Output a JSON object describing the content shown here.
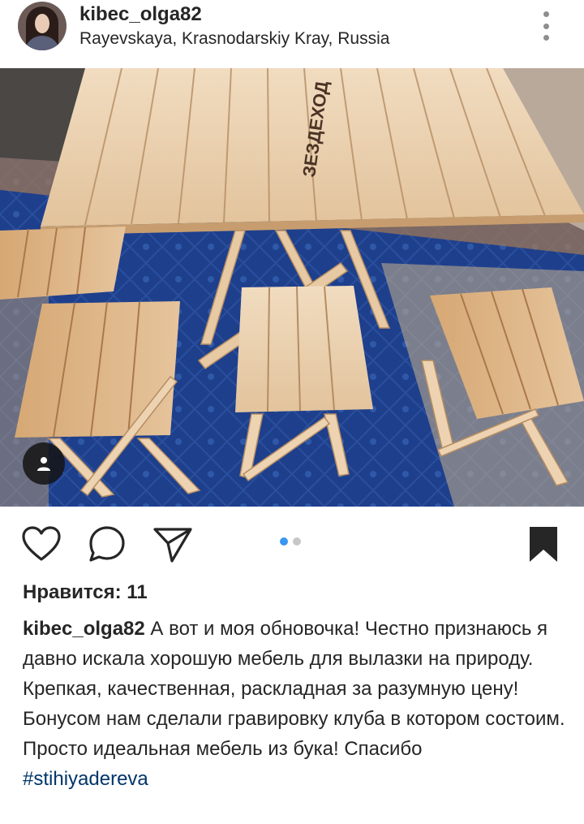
{
  "post": {
    "username": "kibec_olga82",
    "location": "Rayevskaya, Krasnodarskiy Kray, Russia"
  },
  "photo": {
    "engraving_text": "ЗЕЗДЕХОД"
  },
  "actions": {
    "carousel_total": 2,
    "carousel_active": 1
  },
  "likes": {
    "text": "Нравится: 11"
  },
  "caption": {
    "username": "kibec_olga82",
    "text": "А вот и моя обновочка!  Честно признаюсь я давно искала хорошую мебель для вылазки на природу.  Крепкая,  качественная, раскладная за разумную цену! Бонусом нам сделали гравировку клуба в котором состоим. Просто идеальная мебель из бука!  Спасибо",
    "hashtag": "#stihiyadereva"
  },
  "colors": {
    "text": "#262626",
    "hashtag": "#003569",
    "dot_active": "#3897f0",
    "dot_inactive": "#c7c7c7",
    "icon_gray": "#8e8e8e"
  },
  "icons": {
    "like": "heart-icon",
    "comment": "comment-icon",
    "share": "paper-plane-icon",
    "save": "bookmark-icon",
    "more": "three-dots-vertical-icon",
    "tag": "user-tag-icon"
  }
}
